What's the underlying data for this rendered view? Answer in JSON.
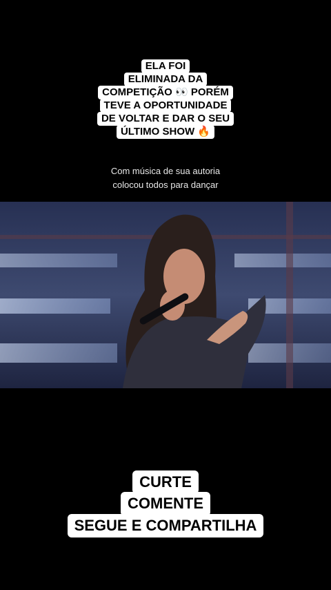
{
  "top_caption": {
    "lines": [
      "ELA FOI",
      "ELIMINADA DA",
      "COMPETIÇÃO 👀 PORÉM",
      "TEVE A OPORTUNIDADE",
      "DE VOLTAR E DAR O SEU",
      "ÚLTIMO SHOW 🔥"
    ]
  },
  "subtitle": {
    "lines": [
      "Com música de sua autoria",
      "colocou todos para dançar"
    ]
  },
  "video": {
    "icon": "video-frame-singer"
  },
  "bottom_caption": {
    "lines": [
      "CURTE",
      "COMENTE",
      "SEGUE E COMPARTILHA"
    ]
  }
}
